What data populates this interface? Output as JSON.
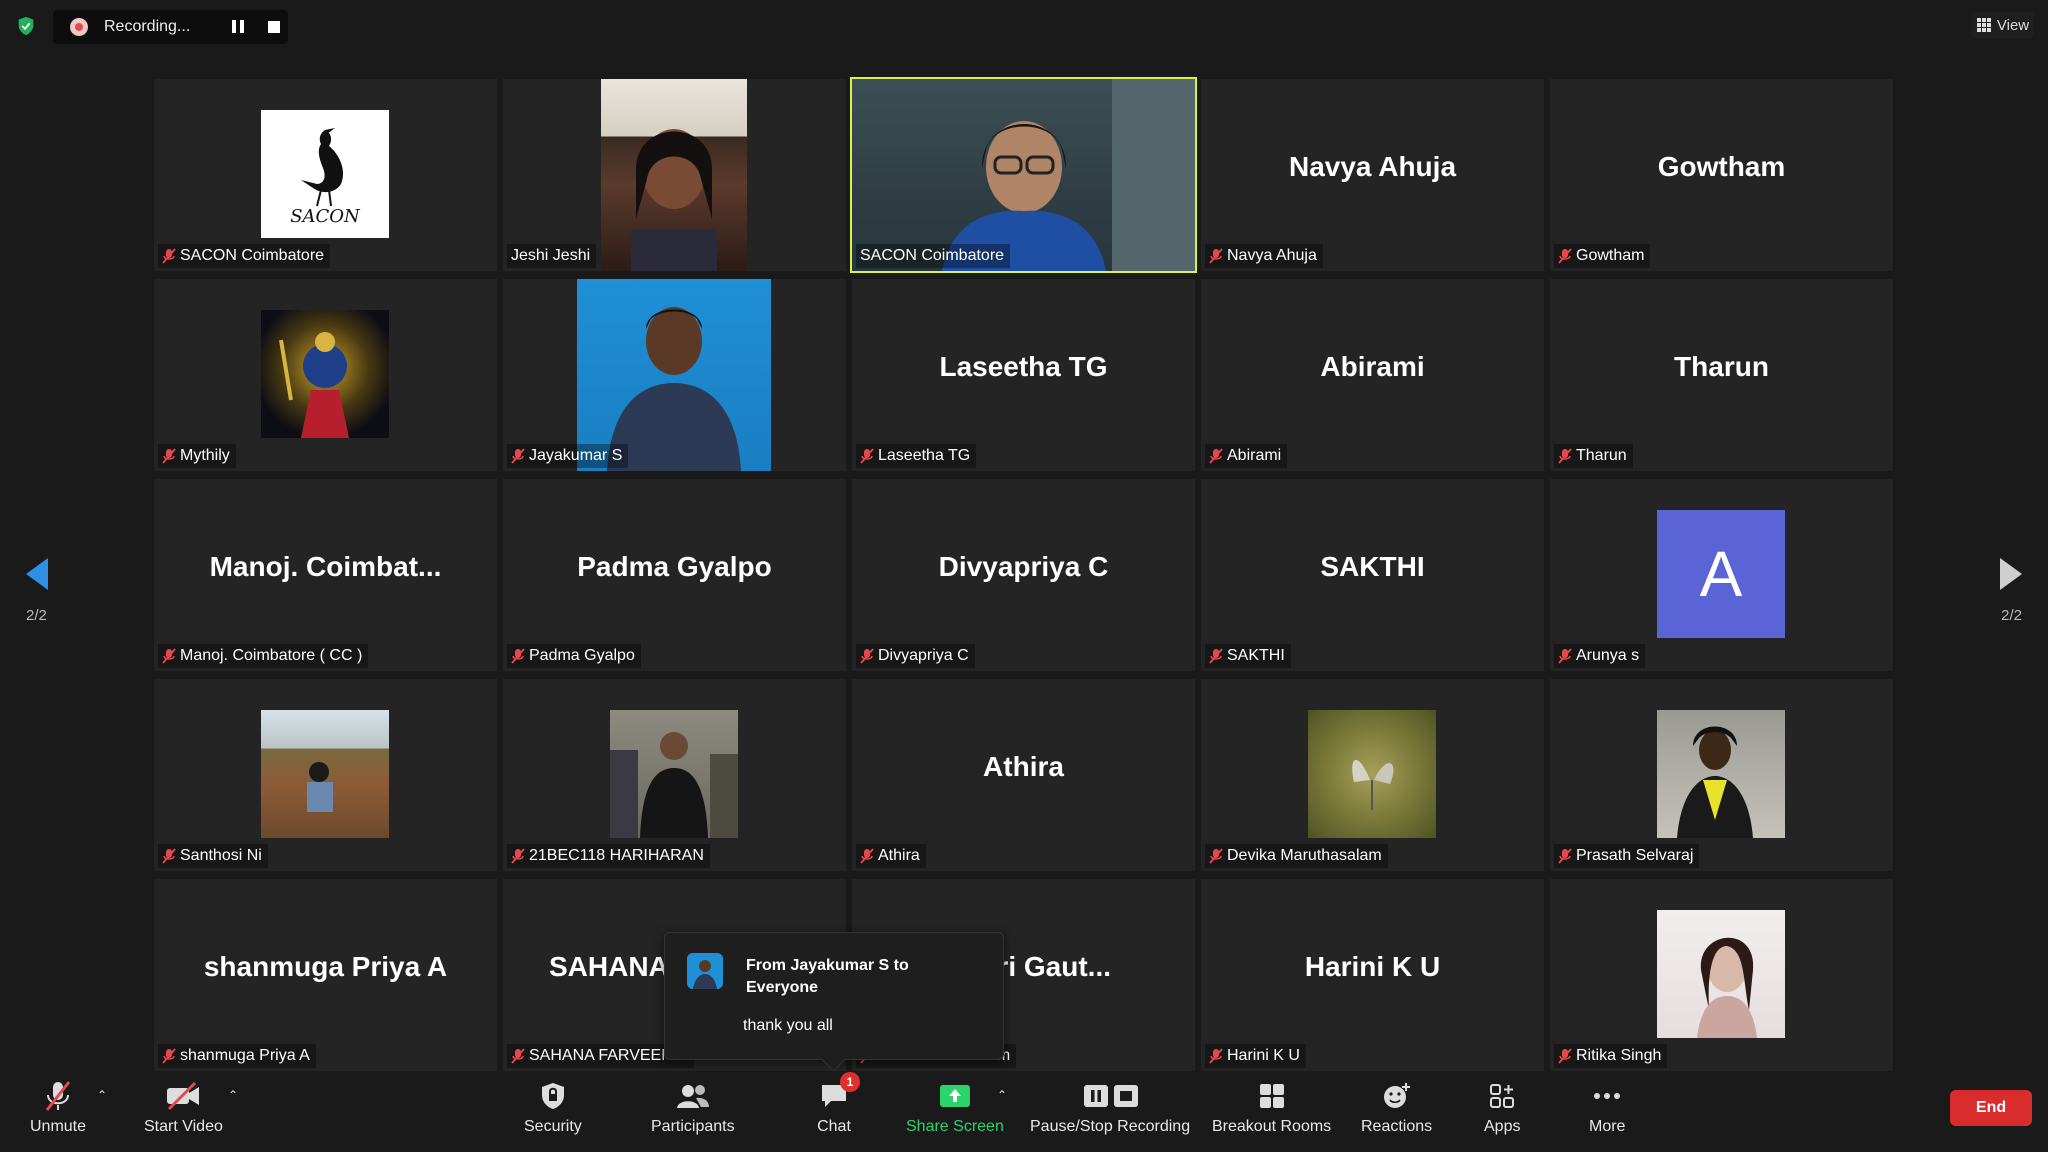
{
  "top_bar": {
    "recording_label": "Recording...",
    "view_label": "View"
  },
  "pagination": {
    "left_page": "2/2",
    "right_page": "2/2"
  },
  "tiles": [
    {
      "display": "logo",
      "label": "SACON Coimbatore",
      "muted": true
    },
    {
      "display": "photo",
      "label": "Jeshi Jeshi",
      "muted": false
    },
    {
      "display": "video",
      "label": "SACON Coimbatore",
      "muted": false,
      "active": true
    },
    {
      "display": "name",
      "big_name": "Navya Ahuja",
      "label": "Navya Ahuja",
      "muted": true
    },
    {
      "display": "name",
      "big_name": "Gowtham",
      "label": "Gowtham",
      "muted": true
    },
    {
      "display": "photo",
      "label": "Mythily",
      "muted": true
    },
    {
      "display": "photo",
      "label": "Jayakumar S",
      "muted": true
    },
    {
      "display": "name",
      "big_name": "Laseetha TG",
      "label": "Laseetha TG",
      "muted": true
    },
    {
      "display": "name",
      "big_name": "Abirami",
      "label": "Abirami",
      "muted": true
    },
    {
      "display": "name",
      "big_name": "Tharun",
      "label": "Tharun",
      "muted": true
    },
    {
      "display": "name",
      "big_name": "Manoj.  Coimbat...",
      "label": "Manoj. Coimbatore ( CC )",
      "muted": true
    },
    {
      "display": "name",
      "big_name": "Padma Gyalpo",
      "label": "Padma Gyalpo",
      "muted": true
    },
    {
      "display": "name",
      "big_name": "Divyapriya C",
      "label": "Divyapriya C",
      "muted": true
    },
    {
      "display": "name",
      "big_name": "SAKTHI",
      "label": "SAKTHI",
      "muted": true
    },
    {
      "display": "letter",
      "letter": "A",
      "label": "Arunya s",
      "muted": true
    },
    {
      "display": "photo",
      "label": "Santhosi Ni",
      "muted": true
    },
    {
      "display": "photo",
      "label": "21BEC118 HARIHARAN",
      "muted": true
    },
    {
      "display": "name",
      "big_name": "Athira",
      "label": "Athira",
      "muted": true
    },
    {
      "display": "photo",
      "label": "Devika Maruthasalam",
      "muted": true
    },
    {
      "display": "photo",
      "label": "Prasath Selvaraj",
      "muted": true
    },
    {
      "display": "name",
      "big_name": "shanmuga Priya A",
      "label": "shanmuga Priya A",
      "muted": true
    },
    {
      "display": "name",
      "big_name": "SAHANA",
      "label": "SAHANA FARVEEN K",
      "muted": true
    },
    {
      "display": "name",
      "big_name": "shri  Gaut...",
      "label": "Vinthushri Gautam",
      "muted": true
    },
    {
      "display": "name",
      "big_name": "Harini K U",
      "label": "Harini K U",
      "muted": true
    },
    {
      "display": "photo",
      "label": "Ritika Singh",
      "muted": true
    }
  ],
  "chat_popup": {
    "from": "From Jayakumar S to Everyone",
    "message": "thank you all"
  },
  "toolbar": {
    "unmute": "Unmute",
    "start_video": "Start Video",
    "security": "Security",
    "participants": "Participants",
    "chat": "Chat",
    "chat_badge": "1",
    "share_screen": "Share Screen",
    "pause_stop_recording": "Pause/Stop Recording",
    "breakout_rooms": "Breakout Rooms",
    "reactions": "Reactions",
    "apps": "Apps",
    "more": "More",
    "end": "End"
  },
  "colors": {
    "active_speaker_border": "#d8f34a",
    "share_green": "#2bd36b",
    "end_red": "#d92d2d",
    "mic_muted_red": "#e5484d",
    "letter_avatar_bg": "#5a64d6"
  }
}
